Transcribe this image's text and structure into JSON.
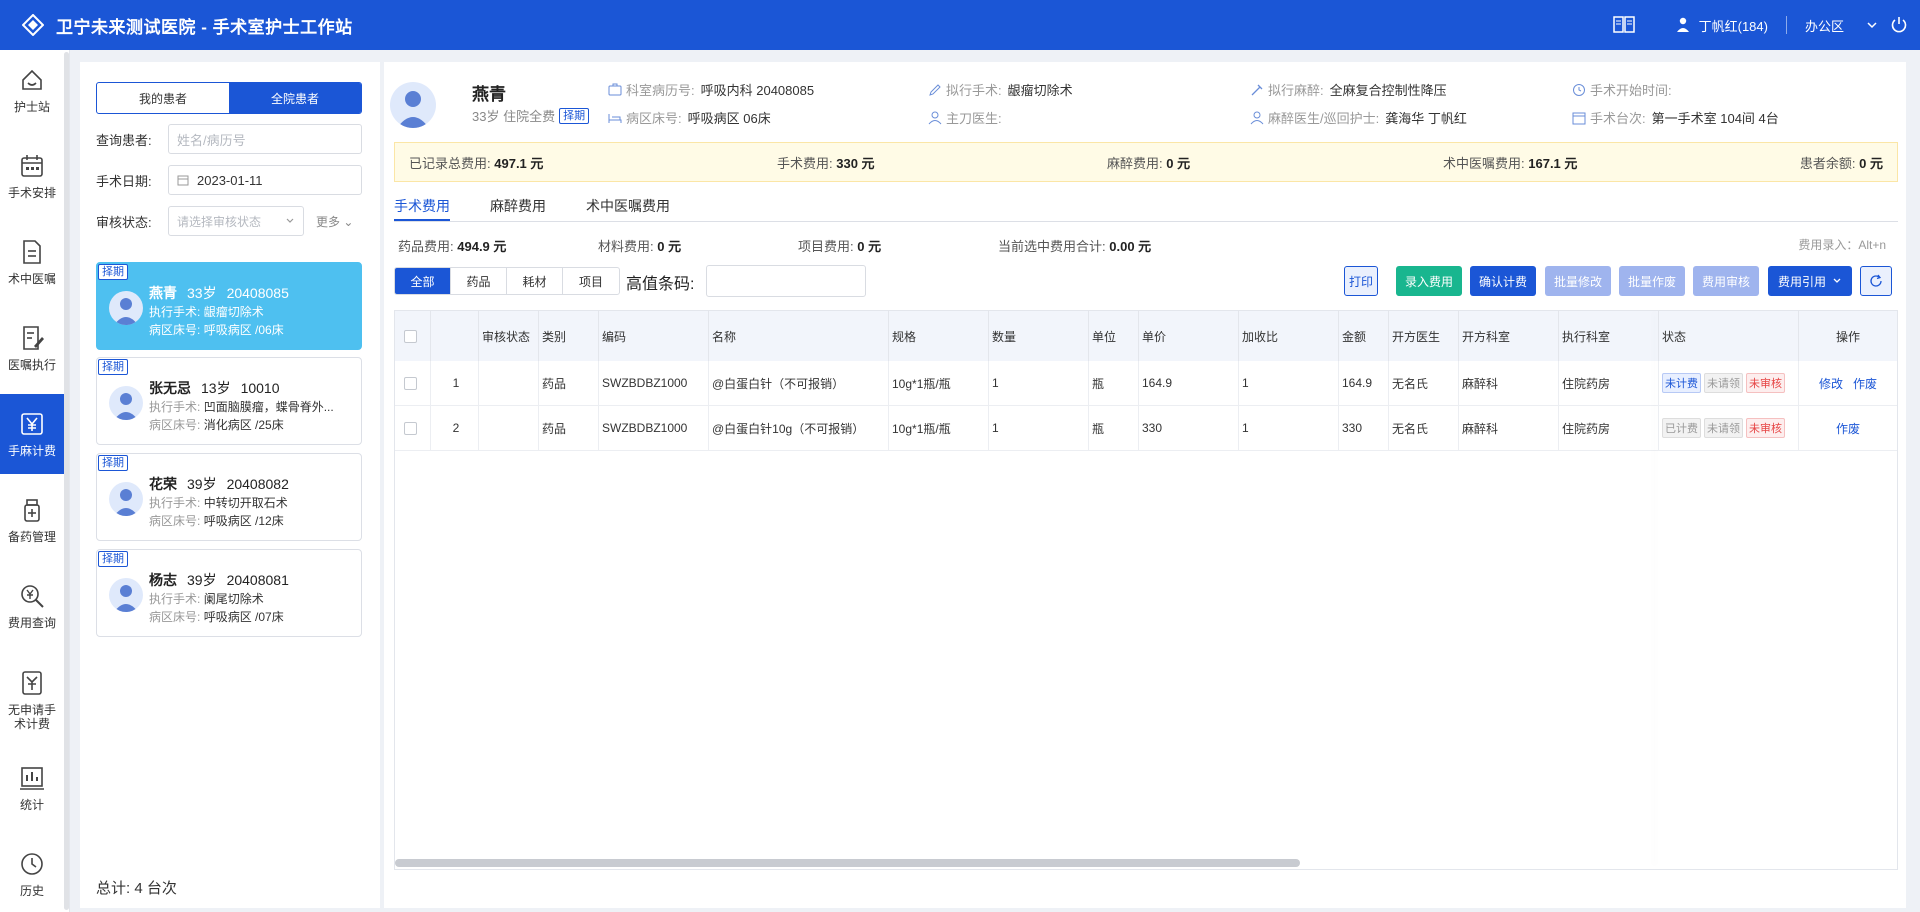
{
  "app": {
    "title": "卫宁未来测试医院 - 手术室护士工作站"
  },
  "topbar": {
    "user": "丁帆红(184)",
    "office": "办公区"
  },
  "nav": [
    {
      "label": "护士站",
      "icon": "nurse-station-icon"
    },
    {
      "label": "手术安排",
      "icon": "calendar-icon"
    },
    {
      "label": "术中医嘱",
      "icon": "document-icon"
    },
    {
      "label": "医嘱执行",
      "icon": "edit-document-icon"
    },
    {
      "label": "手麻计费",
      "icon": "yuan-icon"
    },
    {
      "label": "备药管理",
      "icon": "medicine-icon"
    },
    {
      "label": "费用查询",
      "icon": "yuan-search-icon"
    },
    {
      "label": "无申请手术计费",
      "icon": "yuan-doc-icon"
    },
    {
      "label": "统计",
      "icon": "stats-icon"
    },
    {
      "label": "历史",
      "icon": "history-icon"
    }
  ],
  "left": {
    "seg_my": "我的患者",
    "seg_all": "全院患者",
    "query_label": "查询患者:",
    "query_placeholder": "姓名/病历号",
    "date_label": "手术日期:",
    "date_value": "2023-01-11",
    "audit_label": "审核状态:",
    "audit_placeholder": "请选择审核状态",
    "more": "更多",
    "patients": [
      {
        "tag": "择期",
        "name": "燕青",
        "age": "33岁",
        "id": "20408085",
        "op_label": "执行手术:",
        "op": "龈瘤切除术",
        "bed_label": "病区床号:",
        "bed": "呼吸病区 /06床"
      },
      {
        "tag": "择期",
        "name": "张无忌",
        "age": "13岁",
        "id": "10010",
        "op_label": "执行手术:",
        "op": "凹面脑膜瘤，蝶骨脊外...",
        "bed_label": "病区床号:",
        "bed": "消化病区 /25床"
      },
      {
        "tag": "择期",
        "name": "花荣",
        "age": "39岁",
        "id": "20408082",
        "op_label": "执行手术:",
        "op": "中转切开取石术",
        "bed_label": "病区床号:",
        "bed": "呼吸病区 /12床"
      },
      {
        "tag": "择期",
        "name": "杨志",
        "age": "39岁",
        "id": "20408081",
        "op_label": "执行手术:",
        "op": "阑尾切除术",
        "bed_label": "病区床号:",
        "bed": "呼吸病区 /07床"
      }
    ],
    "total": "总计:  4 台次"
  },
  "header": {
    "name": "燕青",
    "sub": "33岁 住院全费",
    "tag": "择期",
    "dept_label": "科室病历号:",
    "dept": "呼吸内科 20408085",
    "ward_label": "病区床号:",
    "ward": "呼吸病区 06床",
    "plan_op_label": "拟行手术:",
    "plan_op": "龈瘤切除术",
    "surgeon_label": "主刀医生:",
    "surgeon": "",
    "plan_anes_label": "拟行麻醉:",
    "plan_anes": "全麻复合控制性降压",
    "anes_doc_label": "麻醉医生/巡回护士:",
    "anes_doc": "龚海华 丁帆红",
    "start_label": "手术开始时间:",
    "start": "",
    "room_label": "手术台次:",
    "room": "第一手术室 104间 4台"
  },
  "summary": {
    "total_label": "已记录总费用:",
    "total": "497.1 元",
    "op_label": "手术费用:",
    "op": "330 元",
    "anes_label": "麻醉费用:",
    "anes": "0 元",
    "order_label": "术中医嘱费用:",
    "order": "167.1 元",
    "balance_label": "患者余额:",
    "balance": "0 元"
  },
  "tabs": [
    "手术费用",
    "麻醉费用",
    "术中医嘱费用"
  ],
  "fees": {
    "drug_label": "药品费用:",
    "drug": "494.9 元",
    "mat_label": "材料费用:",
    "mat": "0 元",
    "item_label": "项目费用:",
    "item": "0 元",
    "sel_label": "当前选中费用合计:",
    "sel": "0.00 元",
    "hint": "费用录入：Alt+n"
  },
  "filter": [
    "全部",
    "药品",
    "耗材",
    "项目"
  ],
  "barcode_label": "高值条码:",
  "buttons": {
    "print": "打印",
    "enter": "录入费用",
    "confirm": "确认计费",
    "batch_edit": "批量修改",
    "batch_void": "批量作废",
    "audit": "费用审核",
    "quote": "费用引用"
  },
  "colors": {
    "primary": "#1b56d6",
    "green": "#19b68f",
    "disabled": "#9fb4ee"
  },
  "table": {
    "headers": [
      "",
      "",
      "审核状态",
      "类别",
      "编码",
      "名称",
      "规格",
      "数量",
      "单位",
      "单价",
      "加收比",
      "金额",
      "开方医生",
      "开方科室",
      "执行科室",
      "状态",
      "操作"
    ],
    "rows": [
      {
        "no": "1",
        "audit": "",
        "cat": "药品",
        "code": "SWZBDBZ1000",
        "name": "@白蛋白针（不可报销）",
        "spec": "10g*1瓶/瓶",
        "qty": "1",
        "unit": "瓶",
        "price": "164.9",
        "ratio": "1",
        "amount": "164.9",
        "doctor": "无名氏",
        "dept": "麻醉科",
        "exec": "住院药房",
        "s1": "未计费",
        "s2": "未请领",
        "s3": "未审核",
        "op1": "修改",
        "op2": "作废"
      },
      {
        "no": "2",
        "audit": "",
        "cat": "药品",
        "code": "SWZBDBZ1000",
        "name": "@白蛋白针10g（不可报销）",
        "spec": "10g*1瓶/瓶",
        "qty": "1",
        "unit": "瓶",
        "price": "330",
        "ratio": "1",
        "amount": "330",
        "doctor": "无名氏",
        "dept": "麻醉科",
        "exec": "住院药房",
        "s1": "已计费",
        "s2": "未请领",
        "s3": "未审核",
        "op1": "",
        "op2": "作废"
      }
    ]
  }
}
